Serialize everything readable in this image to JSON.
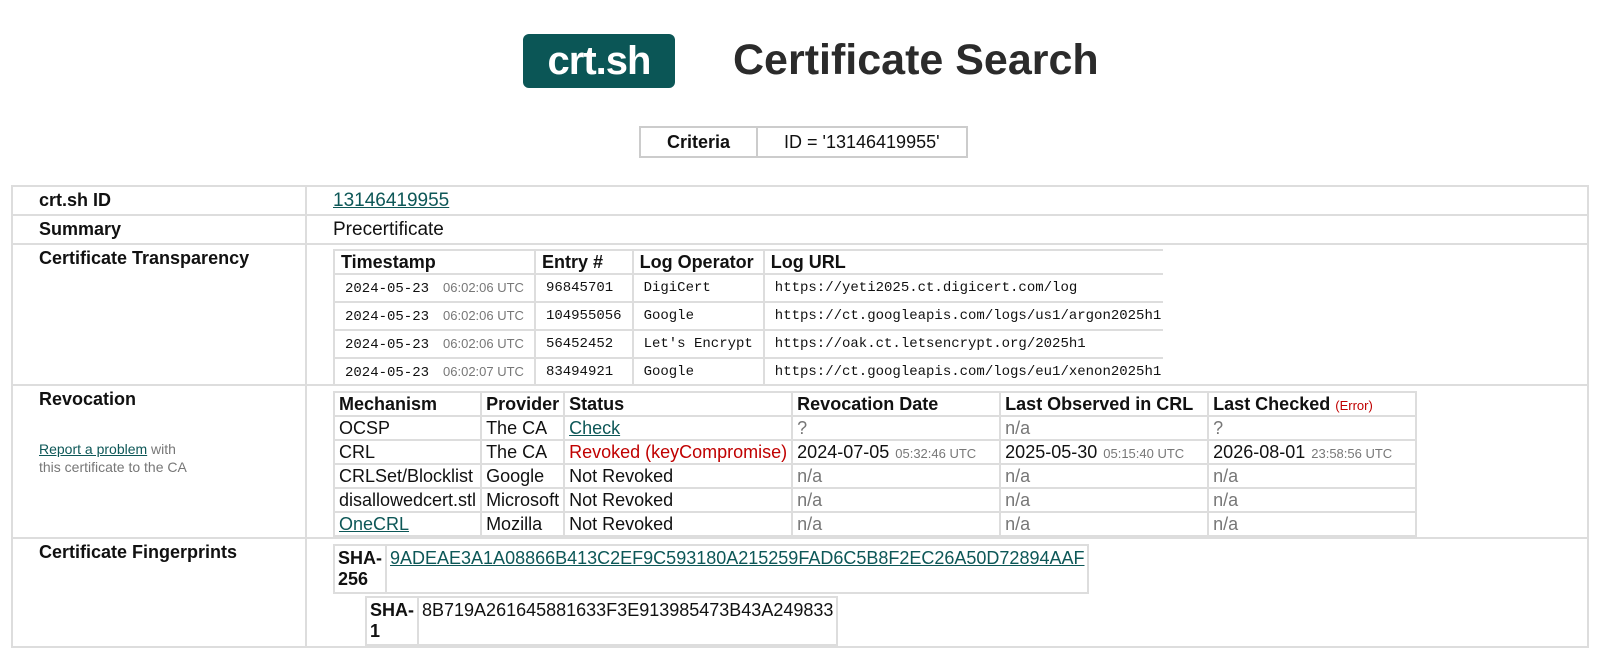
{
  "header": {
    "logo": "crt.sh",
    "title": "Certificate Search"
  },
  "criteria": {
    "label": "Criteria",
    "value": "ID = '13146419955'"
  },
  "rows": {
    "id_label": "crt.sh ID",
    "id_value": "13146419955",
    "summary_label": "Summary",
    "summary_value": "Precertificate",
    "ct_label": "Certificate Transparency",
    "revocation_label": "Revocation",
    "fingerprints_label": "Certificate Fingerprints"
  },
  "report": {
    "link": "Report a problem",
    "tail1": " with",
    "tail2": "this certificate to the CA"
  },
  "ct": {
    "headers": [
      "Timestamp",
      "Entry #",
      "Log Operator",
      "Log URL"
    ],
    "entries": [
      {
        "date": "2024-05-23",
        "time": "06:02:06 UTC",
        "entry": "96845701",
        "operator": "DigiCert",
        "url": "https://yeti2025.ct.digicert.com/log"
      },
      {
        "date": "2024-05-23",
        "time": "06:02:06 UTC",
        "entry": "104955056",
        "operator": "Google",
        "url": "https://ct.googleapis.com/logs/us1/argon2025h1"
      },
      {
        "date": "2024-05-23",
        "time": "06:02:06 UTC",
        "entry": "56452452",
        "operator": "Let's Encrypt",
        "url": "https://oak.ct.letsencrypt.org/2025h1"
      },
      {
        "date": "2024-05-23",
        "time": "06:02:07 UTC",
        "entry": "83494921",
        "operator": "Google",
        "url": "https://ct.googleapis.com/logs/eu1/xenon2025h1"
      }
    ]
  },
  "revocation": {
    "headers": [
      "Mechanism",
      "Provider",
      "Status",
      "Revocation Date",
      "Last Observed in CRL",
      "Last Checked"
    ],
    "error_note": "(Error)",
    "rows": [
      {
        "mechanism": "OCSP",
        "provider": "The CA",
        "status": "Check",
        "rev_date": "?",
        "rev_time": "",
        "observed": "n/a",
        "observed_time": "",
        "checked": "?",
        "checked_time": ""
      },
      {
        "mechanism": "CRL",
        "provider": "The CA",
        "status": "Revoked (keyCompromise)",
        "rev_date": "2024-07-05",
        "rev_time": "05:32:46 UTC",
        "observed": "2025-05-30",
        "observed_time": "05:15:40 UTC",
        "checked": "2026-08-01",
        "checked_time": "23:58:56 UTC"
      },
      {
        "mechanism": "CRLSet/Blocklist",
        "provider": "Google",
        "status": "Not Revoked",
        "rev_date": "n/a",
        "rev_time": "",
        "observed": "n/a",
        "observed_time": "",
        "checked": "n/a",
        "checked_time": ""
      },
      {
        "mechanism": "disallowedcert.stl",
        "provider": "Microsoft",
        "status": "Not Revoked",
        "rev_date": "n/a",
        "rev_time": "",
        "observed": "n/a",
        "observed_time": "",
        "checked": "n/a",
        "checked_time": ""
      },
      {
        "mechanism": "OneCRL",
        "provider": "Mozilla",
        "status": "Not Revoked",
        "rev_date": "n/a",
        "rev_time": "",
        "observed": "n/a",
        "observed_time": "",
        "checked": "n/a",
        "checked_time": ""
      }
    ]
  },
  "fingerprints": {
    "sha256_label": "SHA-256",
    "sha256": "9ADEAE3A1A08866B413C2EF9C593180A215259FAD6C5B8F2EC26A50D72894AAF",
    "sha1_label": "SHA-1",
    "sha1": "8B719A261645881633F3E913985473B43A249833"
  },
  "colors": {
    "brand": "#0b5656",
    "error": "#c00000",
    "muted": "#777777",
    "border": "#dddddd"
  }
}
